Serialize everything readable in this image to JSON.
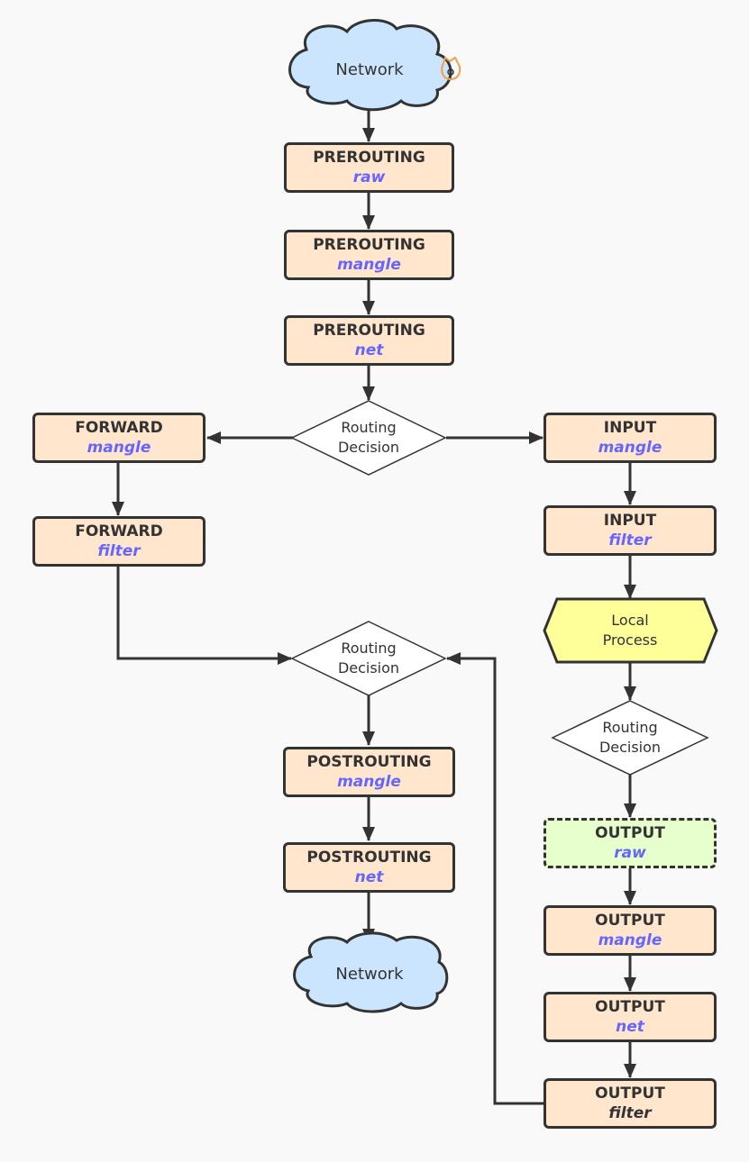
{
  "diagram": {
    "colors": {
      "background": "#f9f9f9",
      "stroke": "#333333",
      "chain_box_fill": "#ffe6cc",
      "optional_box_fill": "#e6ffcc",
      "cloud_fill": "#cce5ff",
      "process_fill": "#ffff99",
      "table_text": "#6666ff"
    },
    "top_network": {
      "label": "Network"
    },
    "bottom_network": {
      "label": "Network"
    },
    "prerouting_raw": {
      "chain": "PREROUTING",
      "table": "raw"
    },
    "prerouting_mangle": {
      "chain": "PREROUTING",
      "table": "mangle"
    },
    "prerouting_net": {
      "chain": "PREROUTING",
      "table": "net"
    },
    "routing_decision_1": {
      "line1": "Routing",
      "line2": "Decision"
    },
    "forward_mangle": {
      "chain": "FORWARD",
      "table": "mangle"
    },
    "forward_filter": {
      "chain": "FORWARD",
      "table": "filter"
    },
    "input_mangle": {
      "chain": "INPUT",
      "table": "mangle"
    },
    "input_filter": {
      "chain": "INPUT",
      "table": "filter"
    },
    "local_process": {
      "line1": "Local",
      "line2": "Process"
    },
    "routing_decision_2": {
      "line1": "Routing",
      "line2": "Decision"
    },
    "routing_decision_3": {
      "line1": "Routing",
      "line2": "Decision"
    },
    "postrouting_mangle": {
      "chain": "POSTROUTING",
      "table": "mangle"
    },
    "postrouting_net": {
      "chain": "POSTROUTING",
      "table": "net"
    },
    "output_raw": {
      "chain": "OUTPUT",
      "table": "raw"
    },
    "output_mangle": {
      "chain": "OUTPUT",
      "table": "mangle"
    },
    "output_net": {
      "chain": "OUTPUT",
      "table": "net"
    },
    "output_filter": {
      "chain": "OUTPUT",
      "table": "filter"
    }
  }
}
